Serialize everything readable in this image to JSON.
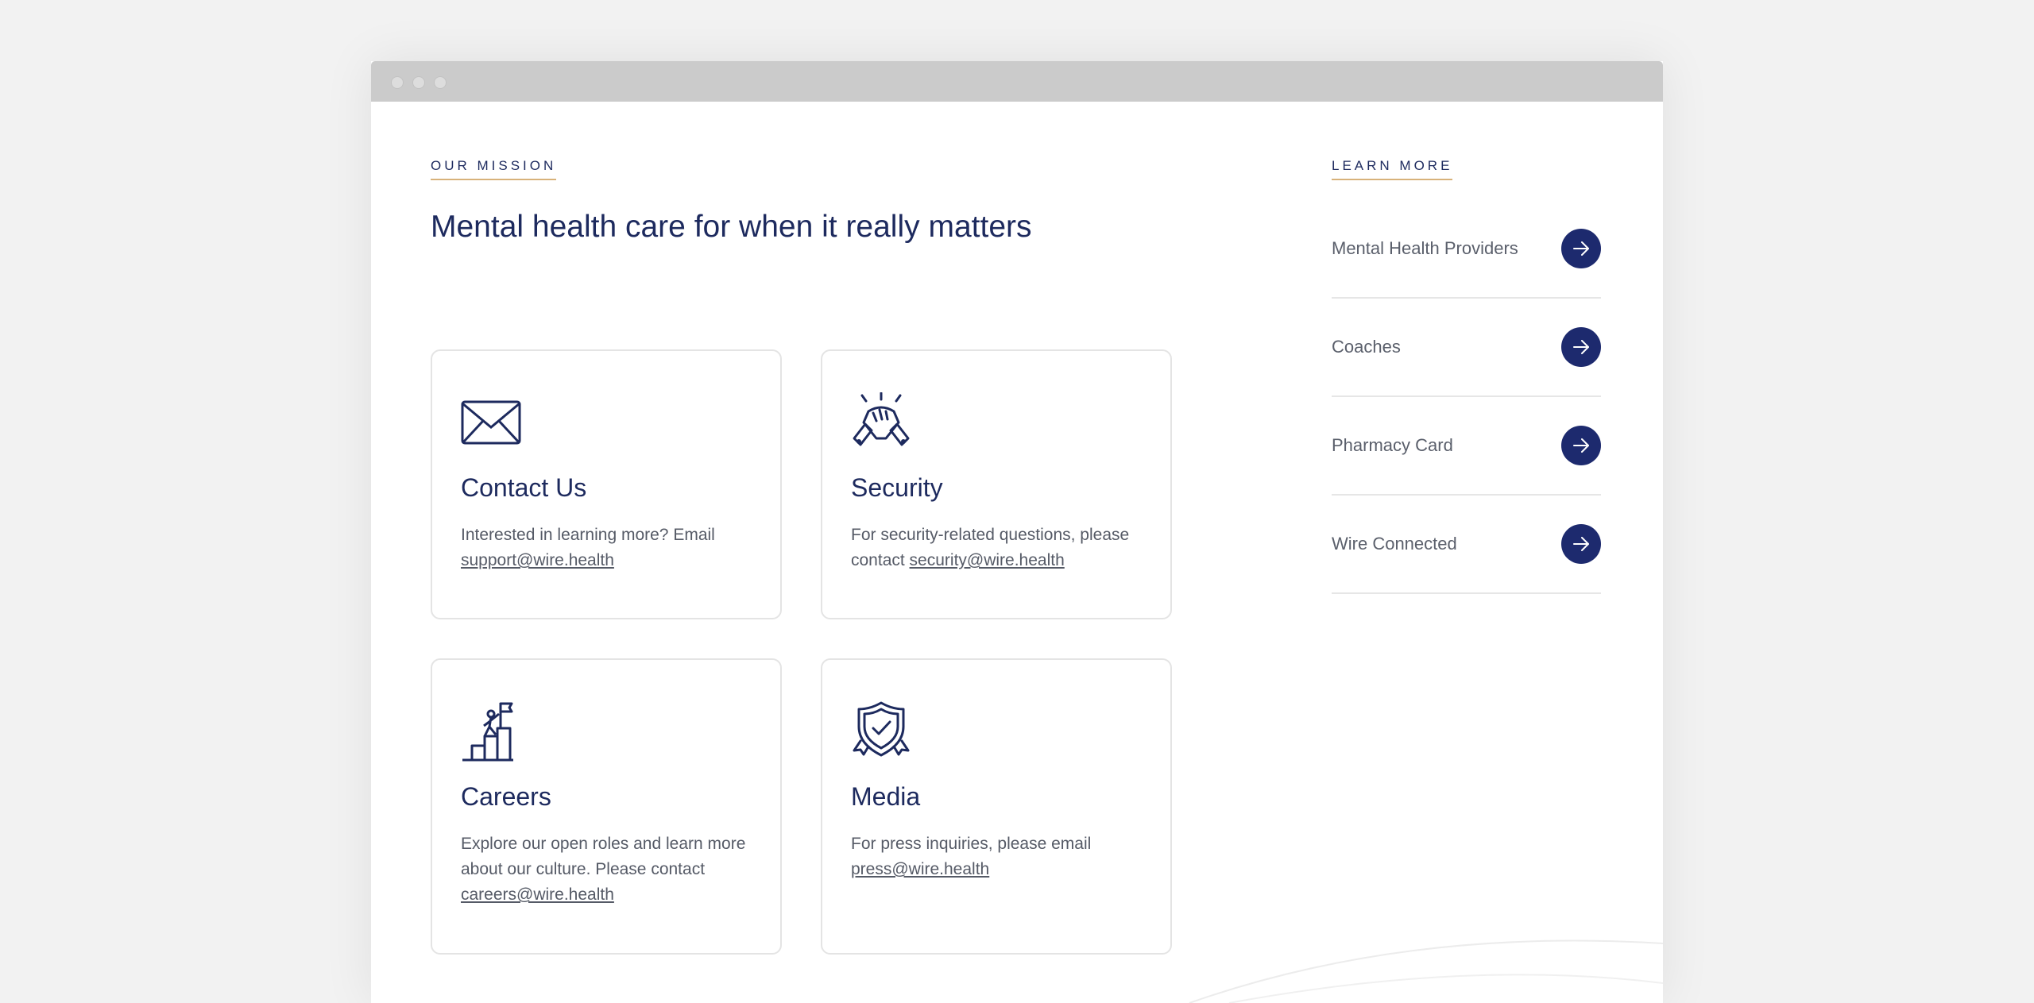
{
  "mission": {
    "eyebrow": "OUR MISSION",
    "headline": "Mental health care for when it really matters"
  },
  "cards": [
    {
      "icon": "envelope-icon",
      "title": "Contact Us",
      "text": "Interested in learning more? Email ",
      "link": "support@wire.health"
    },
    {
      "icon": "clasped-hands-icon",
      "title": "Security",
      "text": "For security-related questions, please contact ",
      "link": "security@wire.health"
    },
    {
      "icon": "summit-flag-icon",
      "title": "Careers",
      "text": "Explore our open roles and learn more about our culture. Please contact ",
      "link": "careers@wire.health"
    },
    {
      "icon": "shield-check-icon",
      "title": "Media",
      "text": "For press inquiries, please email ",
      "link": "press@wire.health"
    }
  ],
  "learn_more": {
    "eyebrow": "LEARN MORE",
    "items": [
      {
        "label": "Mental Health Providers",
        "icon": "arrow-right-icon"
      },
      {
        "label": "Coaches",
        "icon": "arrow-right-icon"
      },
      {
        "label": "Pharmacy Card",
        "icon": "arrow-right-icon"
      },
      {
        "label": "Wire Connected",
        "icon": "arrow-right-icon"
      }
    ]
  },
  "colors": {
    "navy": "#1d2a5e",
    "accent_underline": "#d8b27a",
    "body_text": "#555a66",
    "arrow_bg": "#1d2a6e"
  }
}
